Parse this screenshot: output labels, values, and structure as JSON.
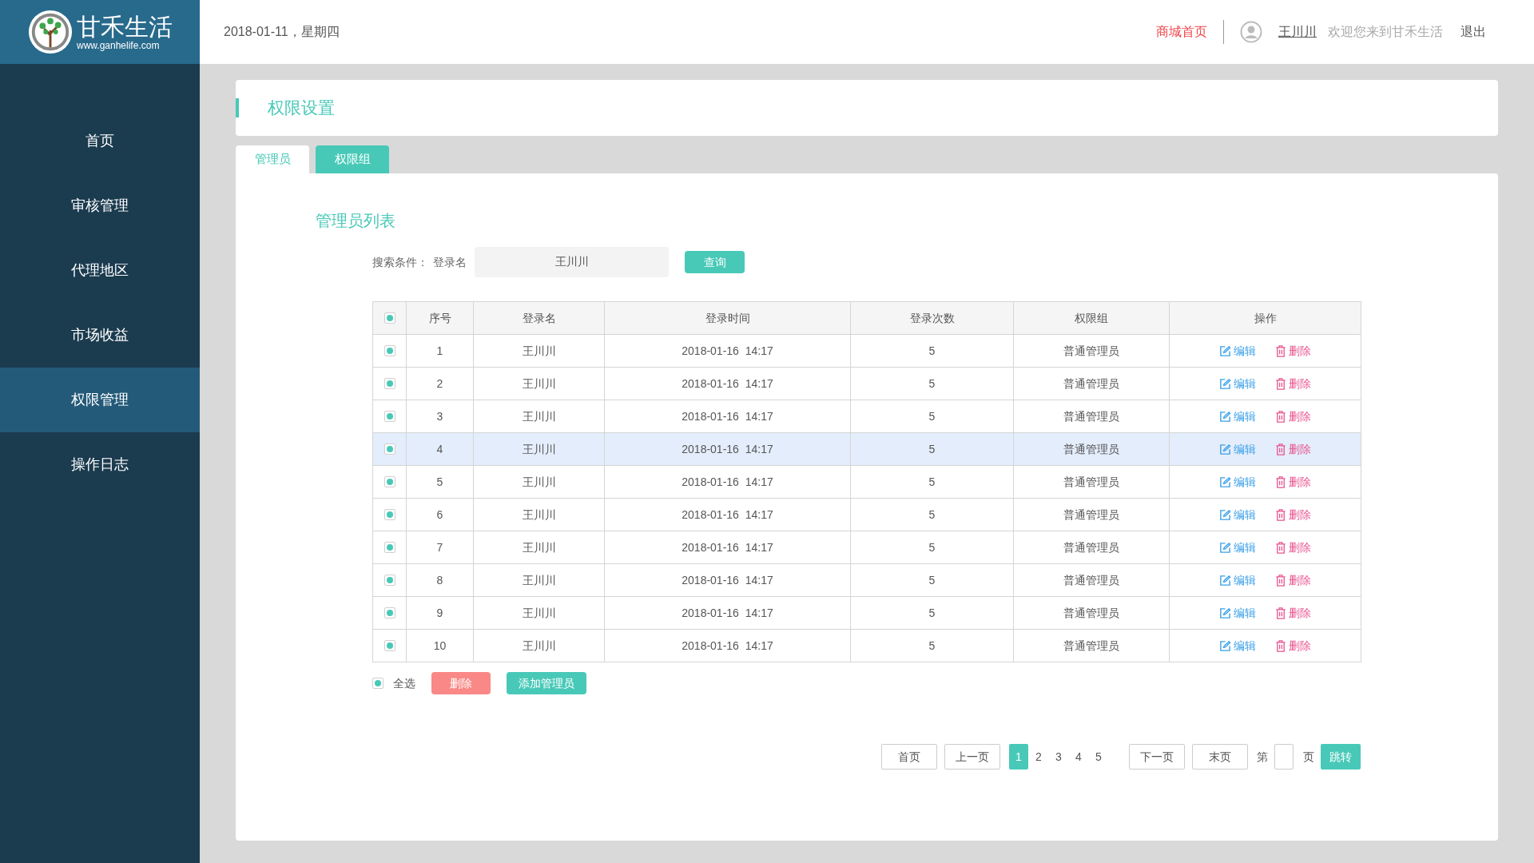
{
  "logo": {
    "name": "甘禾生活",
    "url": "www.ganhelife.com"
  },
  "header": {
    "date": "2018-01-11，星期四",
    "mall_link": "商城首页",
    "username": "王川川",
    "welcome": "欢迎您来到甘禾生活",
    "logout": "退出"
  },
  "sidebar": {
    "items": [
      {
        "label": "首页",
        "selected": false
      },
      {
        "label": "审核管理",
        "selected": false
      },
      {
        "label": "代理地区",
        "selected": false
      },
      {
        "label": "市场收益",
        "selected": false
      },
      {
        "label": "权限管理",
        "selected": true
      },
      {
        "label": "操作日志",
        "selected": false
      }
    ]
  },
  "page_title": "权限设置",
  "tabs": [
    {
      "label": "管理员",
      "selected": true
    },
    {
      "label": "权限组",
      "selected": false
    }
  ],
  "section_title": "管理员列表",
  "search": {
    "label": "搜索条件：",
    "field_label": "登录名",
    "value": "王川川",
    "button": "查询"
  },
  "table": {
    "header_checked": true,
    "columns": [
      "序号",
      "登录名",
      "登录时间",
      "登录次数",
      "权限组",
      "操作"
    ],
    "rows": [
      {
        "checked": true,
        "selected": false,
        "cells": [
          "1",
          "王川川",
          "2018-01-16  14:17",
          "5",
          "普通管理员"
        ],
        "edit": "编辑",
        "delete": "删除"
      },
      {
        "checked": true,
        "selected": false,
        "cells": [
          "2",
          "王川川",
          "2018-01-16  14:17",
          "5",
          "普通管理员"
        ],
        "edit": "编辑",
        "delete": "删除"
      },
      {
        "checked": true,
        "selected": false,
        "cells": [
          "3",
          "王川川",
          "2018-01-16  14:17",
          "5",
          "普通管理员"
        ],
        "edit": "编辑",
        "delete": "删除"
      },
      {
        "checked": true,
        "selected": true,
        "cells": [
          "4",
          "王川川",
          "2018-01-16  14:17",
          "5",
          "普通管理员"
        ],
        "edit": "编辑",
        "delete": "删除"
      },
      {
        "checked": true,
        "selected": false,
        "cells": [
          "5",
          "王川川",
          "2018-01-16  14:17",
          "5",
          "普通管理员"
        ],
        "edit": "编辑",
        "delete": "删除"
      },
      {
        "checked": true,
        "selected": false,
        "cells": [
          "6",
          "王川川",
          "2018-01-16  14:17",
          "5",
          "普通管理员"
        ],
        "edit": "编辑",
        "delete": "删除"
      },
      {
        "checked": true,
        "selected": false,
        "cells": [
          "7",
          "王川川",
          "2018-01-16  14:17",
          "5",
          "普通管理员"
        ],
        "edit": "编辑",
        "delete": "删除"
      },
      {
        "checked": true,
        "selected": false,
        "cells": [
          "8",
          "王川川",
          "2018-01-16  14:17",
          "5",
          "普通管理员"
        ],
        "edit": "编辑",
        "delete": "删除"
      },
      {
        "checked": true,
        "selected": false,
        "cells": [
          "9",
          "王川川",
          "2018-01-16  14:17",
          "5",
          "普通管理员"
        ],
        "edit": "编辑",
        "delete": "删除"
      },
      {
        "checked": true,
        "selected": false,
        "cells": [
          "10",
          "王川川",
          "2018-01-16  14:17",
          "5",
          "普通管理员"
        ],
        "edit": "编辑",
        "delete": "删除"
      }
    ]
  },
  "bulk": {
    "select_all": {
      "label": "全选",
      "checked": true
    },
    "delete": "删除",
    "add": "添加管理员"
  },
  "pagination": {
    "first": "首页",
    "prev": "上一页",
    "pages": [
      {
        "label": "1",
        "selected": true
      },
      {
        "label": "2",
        "selected": false
      },
      {
        "label": "3",
        "selected": false
      },
      {
        "label": "4",
        "selected": false
      },
      {
        "label": "5",
        "selected": false
      }
    ],
    "next": "下一页",
    "last": "末页",
    "goto_prefix": "第",
    "goto_suffix": "页",
    "goto_button": "跳转"
  }
}
